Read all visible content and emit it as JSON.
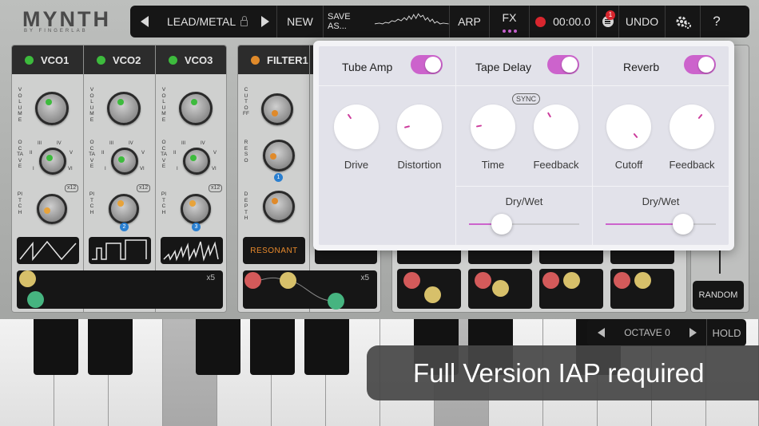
{
  "logo": {
    "title": "MYNTH",
    "subtitle": "BY FINGERLAB"
  },
  "toolbar": {
    "preset_name": "LEAD/METAL",
    "new_label": "NEW",
    "save_as_label": "SAVE AS...",
    "arp_label": "ARP",
    "fx_label": "FX",
    "record_time": "00:00.0",
    "notification_count": "1",
    "undo_label": "UNDO",
    "help_label": "?"
  },
  "vco": [
    {
      "name": "VCO1",
      "led_color": "#3dbb3d",
      "volume_label": "VOLUME",
      "octave_label": "OCTAVE",
      "pitch_label": "PITCH",
      "pitch_mult": "x12",
      "badge": ""
    },
    {
      "name": "VCO2",
      "led_color": "#3dbb3d",
      "volume_label": "VOLUME",
      "octave_label": "OCTAVE",
      "pitch_label": "PITCH",
      "pitch_mult": "x12",
      "badge": "2"
    },
    {
      "name": "VCO3",
      "led_color": "#3dbb3d",
      "volume_label": "VOLUME",
      "octave_label": "OCTAVE",
      "pitch_label": "PITCH",
      "pitch_mult": "x12",
      "badge": "3"
    }
  ],
  "octave_numerals": [
    "I",
    "II",
    "III",
    "IV",
    "V",
    "VI"
  ],
  "filter": {
    "name": "FILTER1",
    "led_color": "#e08a2a",
    "cutoff_label": "CUTOFF",
    "reso_label": "RESO",
    "depth_label": "DEPTH",
    "badge": "1",
    "mode_button": "RESONANT"
  },
  "xy_multiplier": "x5",
  "random_label": "RANDOM",
  "octave_control": {
    "label": "OCTAVE 0",
    "hold_label": "HOLD"
  },
  "banner_text": "Full Version IAP required",
  "fx": {
    "accent_color": "#cc63cc",
    "tube_amp": {
      "name": "Tube Amp",
      "enabled": true,
      "knob1": "Drive",
      "knob2": "Distortion"
    },
    "tape_delay": {
      "name": "Tape Delay",
      "enabled": true,
      "sync_label": "SYNC",
      "knob1": "Time",
      "knob2": "Feedback",
      "drywet_label": "Dry/Wet",
      "drywet_value": 0.3
    },
    "reverb": {
      "name": "Reverb",
      "enabled": true,
      "knob1": "Cutoff",
      "knob2": "Feedback",
      "drywet_label": "Dry/Wet",
      "drywet_value": 0.7
    }
  }
}
